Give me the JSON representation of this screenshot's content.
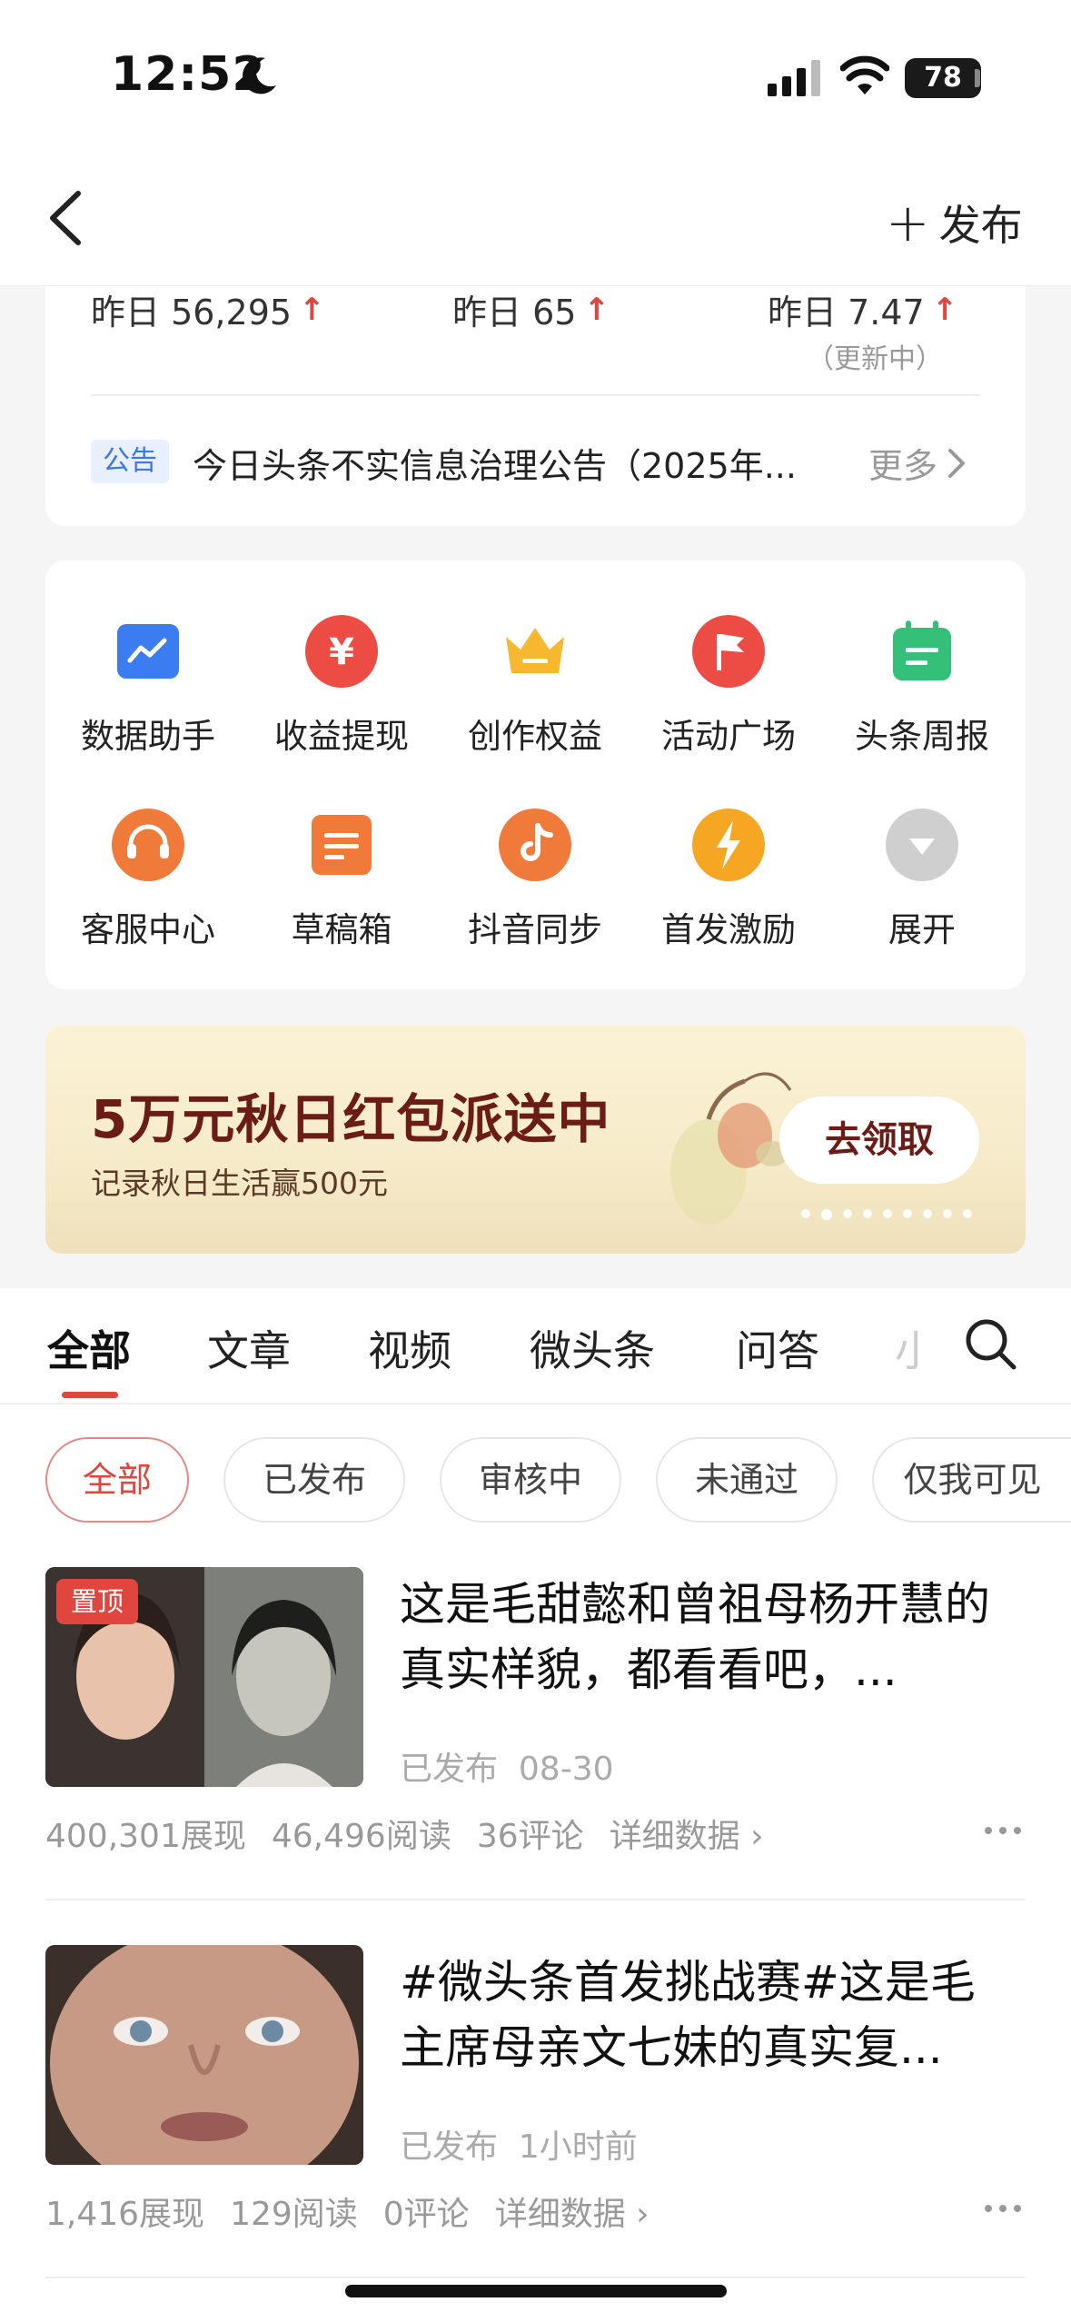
{
  "status_bar": {
    "time": "12:52",
    "battery": "78"
  },
  "header": {
    "publish_label": "发布"
  },
  "stats": [
    {
      "label": "昨日 56,295"
    },
    {
      "label": "昨日 65"
    },
    {
      "label": "昨日 7.47",
      "sub": "（更新中）"
    }
  ],
  "notice": {
    "tag": "公告",
    "text": "今日头条不实信息治理公告（2025年...",
    "more": "更多"
  },
  "tools": [
    {
      "label": "数据助手",
      "icon": "chart-icon",
      "color": "#3b7cf0"
    },
    {
      "label": "收益提现",
      "icon": "yuan-icon",
      "color": "#ec4c44"
    },
    {
      "label": "创作权益",
      "icon": "crown-icon",
      "color": "#f5b82e"
    },
    {
      "label": "活动广场",
      "icon": "flag-icon",
      "color": "#ec4c44"
    },
    {
      "label": "头条周报",
      "icon": "calendar-icon",
      "color": "#35c07a"
    },
    {
      "label": "客服中心",
      "icon": "headset-icon",
      "color": "#f07a3a"
    },
    {
      "label": "草稿箱",
      "icon": "draft-icon",
      "color": "#f07a3a"
    },
    {
      "label": "抖音同步",
      "icon": "douyin-icon",
      "color": "#f07a3a"
    },
    {
      "label": "首发激励",
      "icon": "lightning-icon",
      "color": "#f5a623"
    },
    {
      "label": "展开",
      "icon": "expand-icon",
      "color": "#cfcfcf"
    }
  ],
  "banner": {
    "title": "5万元秋日红包派送中",
    "subtitle": "记录秋日生活赢500元",
    "button": "去领取"
  },
  "tabs": [
    "全部",
    "文章",
    "视频",
    "微头条",
    "问答",
    "小"
  ],
  "filters": [
    "全部",
    "已发布",
    "审核中",
    "未通过",
    "仅我可见"
  ],
  "articles": [
    {
      "pinned": "置顶",
      "title": "这是毛甜懿和曾祖母杨开慧的真实样貌，都看看吧，...",
      "status": "已发布",
      "time": "08-30",
      "views": "400,301展现",
      "reads": "46,496阅读",
      "comments": "36评论",
      "detail": "详细数据"
    },
    {
      "title": "#微头条首发挑战赛#这是毛主席母亲文七妹的真实复...",
      "status": "已发布",
      "time": "1小时前",
      "views": "1,416展现",
      "reads": "129阅读",
      "comments": "0评论",
      "detail": "详细数据"
    }
  ],
  "colors": {
    "accent": "#e0463e",
    "banner_text": "#6b1c17"
  }
}
